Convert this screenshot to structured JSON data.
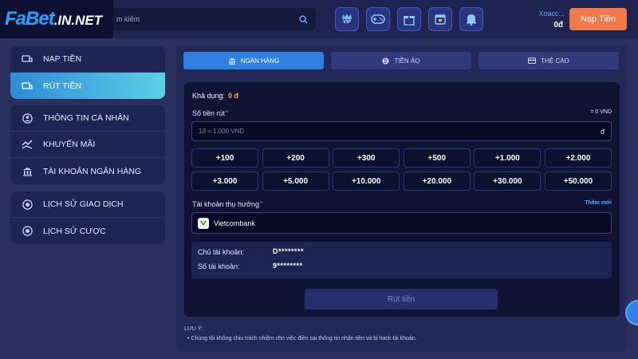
{
  "brand": {
    "logo_main": "FaBet",
    "logo_suffix": ".IN.NET"
  },
  "search": {
    "placeholder": "m kiếm",
    "icon": "search-icon"
  },
  "header_icons": [
    "vip-icon",
    "gamepad-icon",
    "gift-icon",
    "calendar-icon",
    "bell-icon"
  ],
  "header_vip_label": "VIP",
  "user": {
    "name": "Xoacc...",
    "balance": "0đ",
    "deposit_label": "Nạp Tiền"
  },
  "sidebar": {
    "group1": [
      {
        "label": "NẠP TIỀN",
        "icon": "deposit-icon",
        "active": false
      },
      {
        "label": "RÚT TIỀN",
        "icon": "withdraw-icon",
        "active": true
      }
    ],
    "group2": [
      {
        "label": "THÔNG TIN CÁ NHÂN",
        "icon": "user-icon"
      },
      {
        "label": "KHUYẾN MÃI",
        "icon": "promo-icon"
      },
      {
        "label": "TÀI KHOẢN NGÂN HÀNG",
        "icon": "bank-icon"
      }
    ],
    "group3": [
      {
        "label": "LỊCH SỬ GIAO DỊCH",
        "icon": "history-icon"
      },
      {
        "label": "LỊCH SỬ CƯỢC",
        "icon": "bet-history-icon"
      }
    ]
  },
  "tabs": [
    {
      "label": "NGÂN HÀNG",
      "icon": "bank-icon",
      "active": true
    },
    {
      "label": "TIỀN ẢO",
      "icon": "crypto-icon",
      "active": false
    },
    {
      "label": "THẺ CÀO",
      "icon": "card-icon",
      "active": false
    }
  ],
  "form": {
    "available_label": "Khả dụng:",
    "available_amount": "0 đ",
    "amount_label": "Số tiền rút",
    "amount_equiv": "= 0 VND",
    "amount_placeholder": "1đ = 1.000 VND",
    "currency": "đ",
    "quick_amounts": [
      "+100",
      "+200",
      "+300",
      "+500",
      "+1.000",
      "+2.000",
      "+3.000",
      "+5.000",
      "+10.000",
      "+20.000",
      "+30.000",
      "+50.000"
    ],
    "bank_label": "Tài khoản thụ hưởng",
    "add_new": "Thêm mới",
    "bank_name": "Vietcombank",
    "holder_label": "Chủ tài khoản:",
    "holder_value": "D********",
    "number_label": "Số tài khoản:",
    "number_value": "9********",
    "submit_label": "Rút tiền"
  },
  "note": {
    "title": "LƯU Ý:",
    "text": "Chúng tôi không chịu trách nhiệm cho việc điền sai thông tin nhận tiền và bị hack tài khoản."
  },
  "colors": {
    "accent": "#2f80e0",
    "deposit": "#f2794a",
    "balance": "#f2b544",
    "required": "#ff4d6a"
  }
}
